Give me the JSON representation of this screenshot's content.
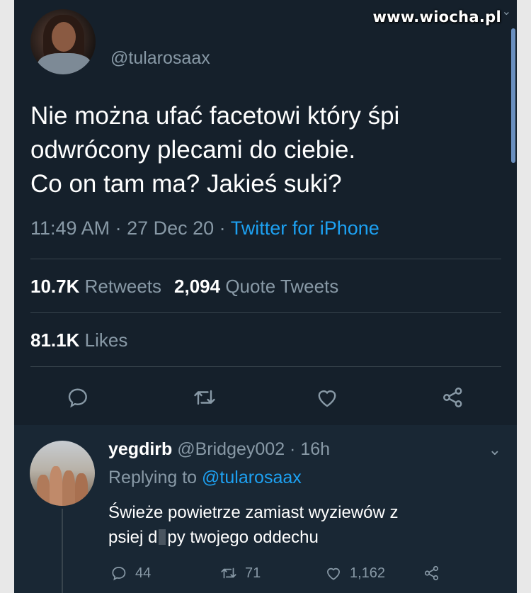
{
  "watermark": "www.wiocha.pl",
  "tweet": {
    "handle": "@tularosaax",
    "text_lines": [
      "Nie można ufać facetowi który śpi",
      "odwrócony plecami do ciebie.",
      "Co on tam ma? Jakieś suki?"
    ],
    "time": "11:49 AM",
    "separator": " · ",
    "date": "27 Dec 20",
    "source": "Twitter for iPhone",
    "retweets_count": "10.7K",
    "retweets_label": "Retweets",
    "quotes_count": "2,094",
    "quotes_label": "Quote Tweets",
    "likes_count": "81.1K",
    "likes_label": "Likes",
    "actions": [
      "reply-icon",
      "retweet-icon",
      "like-icon",
      "share-icon"
    ]
  },
  "reply": {
    "name": "yegdirb",
    "handle": "@Bridgey002",
    "separator": " · ",
    "age": "16h",
    "replying_prefix": "Replying to",
    "replying_to": "@tularosaax",
    "text_line1": "Świeże powietrze zamiast wyziewów z",
    "text_line2_start": "psiej d",
    "text_line2_end": "py twojego oddechu",
    "reply_count": "44",
    "retweet_count": "71",
    "like_count": "1,162"
  },
  "colors": {
    "background": "#15202b",
    "reply_background": "#192734",
    "text": "#ffffff",
    "secondary": "#8899a6",
    "accent": "#1da1f2",
    "divider": "#38444d"
  }
}
